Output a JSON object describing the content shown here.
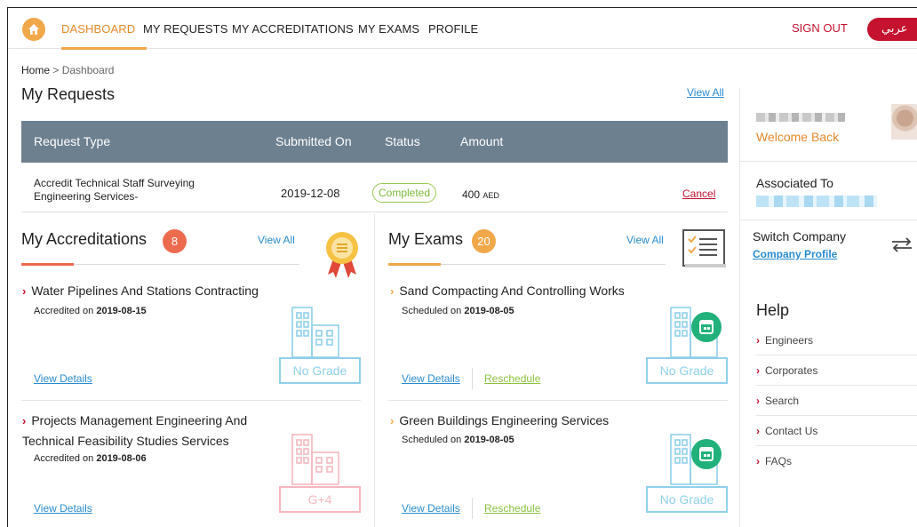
{
  "nav": {
    "items": [
      "DASHBOARD",
      "MY REQUESTS",
      "MY ACCREDITATIONS",
      "MY EXAMS",
      "PROFILE"
    ],
    "sign_out": "SIGN OUT",
    "language": "عربي",
    "accent_color": "#f0a84a"
  },
  "breadcrumb": {
    "home": "Home",
    "separator": " > ",
    "current": "Dashboard"
  },
  "requests": {
    "title": "My Requests",
    "view_all": "View All",
    "columns": [
      "Request Type",
      "Submitted On",
      "Status",
      "Amount"
    ],
    "rows": [
      {
        "type": "Accredit Technical Staff Surveying Engineering Services-",
        "submitted": "2019-12-08",
        "status": "Completed",
        "amount": "400",
        "currency": "AED",
        "action": "Cancel"
      }
    ]
  },
  "accreditations": {
    "title": "My Accreditations",
    "count": "8",
    "view_all": "View All",
    "items": [
      {
        "title": "Water Pipelines And Stations Contracting",
        "sub_label": "Accredited on",
        "date": "2019-08-15",
        "grade": "No Grade",
        "link": "View Details"
      },
      {
        "title": "Projects Management Engineering And Technical Feasibility Studies Services",
        "sub_label": "Accredited on",
        "date": "2019-08-06",
        "grade": "G+4",
        "link": "View Details"
      }
    ]
  },
  "exams": {
    "title": "My Exams",
    "count": "20",
    "view_all": "View All",
    "items": [
      {
        "title": "Sand Compacting And Controlling Works",
        "sub_label": "Scheduled on",
        "date": "2019-08-05",
        "grade": "No Grade",
        "link": "View Details",
        "link2": "Reschedule"
      },
      {
        "title": "Green Buildings Engineering Services",
        "sub_label": "Scheduled on",
        "date": "2019-08-05",
        "grade": "No Grade",
        "link": "View Details",
        "link2": "Reschedule"
      }
    ]
  },
  "sidebar": {
    "welcome": "Welcome Back",
    "associated_to": "Associated To",
    "switch_company": "Switch Company",
    "company_profile": "Company Profile",
    "help_title": "Help",
    "help_items": [
      "Engineers",
      "Corporates",
      "Search",
      "Contact Us",
      "FAQs"
    ]
  },
  "colors": {
    "brand_red": "#c4122f",
    "orange": "#e48a2c",
    "link_blue": "#2a8ccf",
    "green": "#8cc241",
    "table_header": "#6d8090",
    "grade_blue": "#8fd0ea",
    "grade_pink": "#f6b7c0"
  }
}
